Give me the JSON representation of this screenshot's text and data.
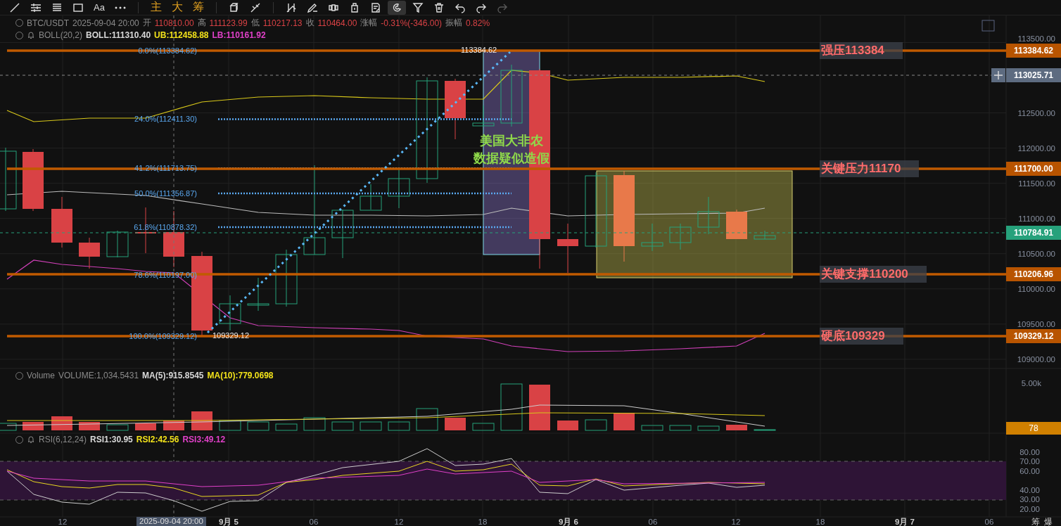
{
  "toolbar": {
    "items": [
      {
        "kind": "icon",
        "selected": false,
        "disabled": false
      },
      {
        "kind": "icon",
        "selected": false,
        "disabled": false
      },
      {
        "kind": "icon",
        "selected": false,
        "disabled": false
      },
      {
        "kind": "icon",
        "selected": false,
        "disabled": false
      },
      {
        "kind": "text",
        "label": "Aa",
        "selected": false,
        "disabled": false
      },
      {
        "kind": "icon",
        "selected": false,
        "disabled": false
      },
      {
        "kind": "accent",
        "label": "主",
        "selected": false,
        "disabled": false
      },
      {
        "kind": "accent",
        "label": "大",
        "selected": false,
        "disabled": false
      },
      {
        "kind": "accent",
        "label": "筹",
        "selected": false,
        "disabled": false
      },
      {
        "kind": "icon",
        "selected": false,
        "disabled": false
      },
      {
        "kind": "icon",
        "selected": false,
        "disabled": false
      },
      {
        "kind": "icon",
        "selected": false,
        "disabled": false
      },
      {
        "kind": "icon",
        "selected": false,
        "disabled": false
      },
      {
        "kind": "icon",
        "selected": false,
        "disabled": false
      },
      {
        "kind": "icon",
        "selected": false,
        "disabled": false
      },
      {
        "kind": "icon",
        "selected": false,
        "disabled": false
      },
      {
        "kind": "icon",
        "selected": true,
        "disabled": false
      },
      {
        "kind": "icon",
        "selected": false,
        "disabled": false
      },
      {
        "kind": "icon",
        "selected": false,
        "disabled": false
      },
      {
        "kind": "icon",
        "selected": false,
        "disabled": false
      },
      {
        "kind": "icon",
        "selected": false,
        "disabled": false
      },
      {
        "kind": "icon",
        "selected": false,
        "disabled": true
      }
    ]
  },
  "legend": {
    "symbol": "BTC/USDT",
    "time": "2025-09-04 20:00",
    "fields": [
      {
        "label": "开",
        "value": "110810.00"
      },
      {
        "label": "高",
        "value": "111123.99"
      },
      {
        "label": "低",
        "value": "110217.13"
      },
      {
        "label": "收",
        "value": "110464.00"
      },
      {
        "label": "涨幅",
        "value": "-0.31%(-346.00)"
      },
      {
        "label": "振幅",
        "value": "0.82%"
      }
    ]
  },
  "boll": {
    "name": "BOLL(20,2)",
    "values": [
      {
        "text": "BOLL:111310.40",
        "color": "#d9d9d9"
      },
      {
        "text": "UB:112458.88",
        "color": "#f2e21a"
      },
      {
        "text": "LB:110161.92",
        "color": "#e040c8"
      }
    ]
  },
  "price_axis": [
    "113500.00",
    "112500.00",
    "112000.00",
    "111500.00",
    "111000.00",
    "110500.00",
    "110000.00",
    "109500.00",
    "109000.00"
  ],
  "price_tags": [
    {
      "text": "113384.62",
      "kind": "level"
    },
    {
      "text": "113025.71",
      "kind": "crosshair"
    },
    {
      "text": "111700.00",
      "kind": "level"
    },
    {
      "text": "110784.91",
      "kind": "last"
    },
    {
      "text": "110206.96",
      "kind": "level"
    },
    {
      "text": "109329.12",
      "kind": "level"
    }
  ],
  "line_labels": [
    "强压113384",
    "关键压力11170",
    "关键支撑110200",
    "硬底109329"
  ],
  "fib": {
    "levels": [
      "0.0%(113384.62)",
      "24.0%(112411.30)",
      "41.2%(111713.75)",
      "50.0%(111356.87)",
      "61.8%(110878.32)",
      "78.6%(110197.00)",
      "100.0%(109329.12)"
    ],
    "high": "113384.62",
    "low": "109329.12"
  },
  "annotation": [
    "美国大非农",
    "数据疑似造假"
  ],
  "volume": {
    "name": "Volume",
    "values": [
      {
        "text": "VOLUME:1,034.5431",
        "color": "#8a8a8a"
      },
      {
        "text": "MA(5):915.8545",
        "color": "#d9d9d9"
      },
      {
        "text": "MA(10):779.0698",
        "color": "#f2e21a"
      }
    ],
    "axis": "5.00k",
    "tag": "78"
  },
  "rsi": {
    "name": "RSI(6,12,24)",
    "values": [
      {
        "text": "RSI1:30.95",
        "color": "#d9d9d9"
      },
      {
        "text": "RSI2:42.56",
        "color": "#f2e21a"
      },
      {
        "text": "RSI3:49.12",
        "color": "#e040c8"
      }
    ],
    "axis": [
      "80.00",
      "70.00",
      "60.00",
      "40.00",
      "30.00",
      "20.00"
    ]
  },
  "time_axis": {
    "labels": [
      "12",
      "9月 5",
      "06",
      "12",
      "18",
      "9月 6",
      "06",
      "12",
      "18",
      "9月 7",
      "06"
    ],
    "crosshair": "2025-09-04 20:00"
  },
  "corner": [
    "筹",
    "爆"
  ]
}
